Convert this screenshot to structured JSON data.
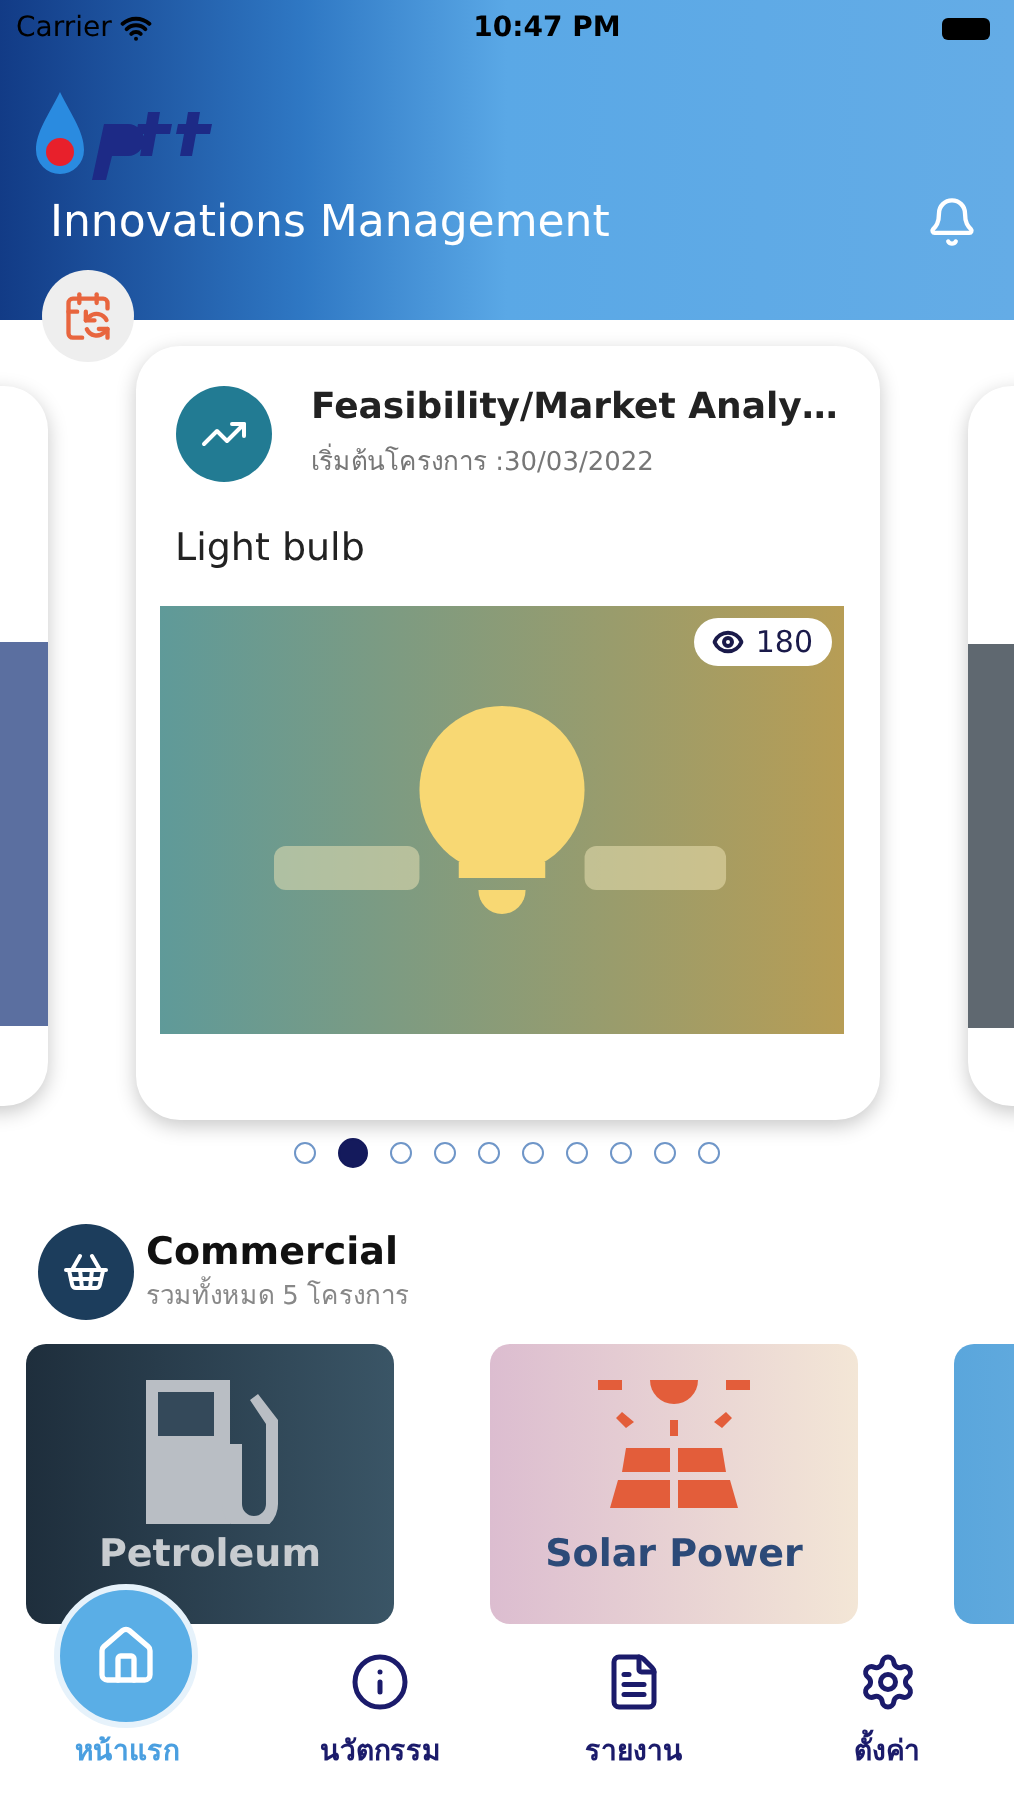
{
  "status_bar": {
    "carrier": "Carrier",
    "time": "10:47 PM"
  },
  "header": {
    "title": "Innovations Management"
  },
  "carousel": {
    "cards": [
      {
        "kind": "peek_left"
      },
      {
        "kind": "full",
        "category": "Feasibility/Market Analy…",
        "start_date": "เริ่มต้นโครงการ :30/03/2022",
        "title": "Light bulb",
        "views": "180"
      },
      {
        "kind": "peek_right"
      }
    ],
    "dots": [
      {
        "selected": false
      },
      {
        "selected": true
      },
      {
        "selected": false
      },
      {
        "selected": false
      },
      {
        "selected": false
      },
      {
        "selected": false
      },
      {
        "selected": false
      },
      {
        "selected": false
      },
      {
        "selected": false
      },
      {
        "selected": false
      }
    ]
  },
  "section": {
    "title": "Commercial",
    "subtitle": "รวมทั้งหมด 5 โครงการ",
    "tiles": [
      {
        "kind": "petroleum",
        "label": "Petroleum"
      },
      {
        "kind": "solar",
        "label": "Solar Power"
      },
      {
        "kind": "blank"
      }
    ]
  },
  "tab_bar": [
    {
      "kind": "home",
      "label": "หน้าแรก",
      "selected": true
    },
    {
      "kind": "info",
      "label": "นวัตกรรม",
      "selected": false
    },
    {
      "kind": "report",
      "label": "รายงาน",
      "selected": false
    },
    {
      "kind": "settings",
      "label": "ตั้งค่า",
      "selected": false
    }
  ]
}
